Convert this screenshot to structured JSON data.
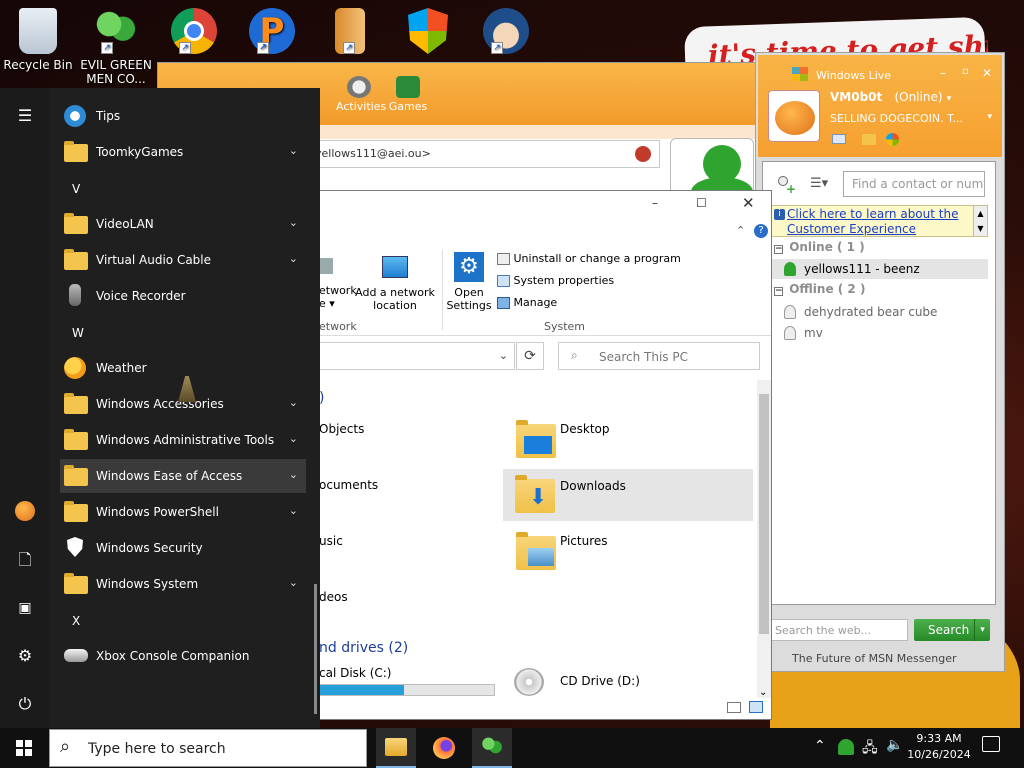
{
  "desktop": {
    "icons": [
      {
        "label": "Recycle Bin",
        "icon": "recycle-bin-icon"
      },
      {
        "label": "EVIL GREEN MEN CO...",
        "icon": "msn-people-icon"
      },
      {
        "label": "",
        "icon": "chrome-icon"
      },
      {
        "label": "",
        "icon": "paint-p-icon"
      },
      {
        "label": "",
        "icon": "bag-app-icon"
      },
      {
        "label": "",
        "icon": "windows-flag-icon"
      },
      {
        "label": "",
        "icon": "anime-character-icon"
      }
    ],
    "wallpaper_text": "it's time to get shit"
  },
  "msn_main": {
    "toolbar": [
      "Activities",
      "Games"
    ],
    "contact_field": "yellows111@aei.ou>"
  },
  "messenger": {
    "title": "Windows Live",
    "username": "VM0b0t",
    "status": "(Online)",
    "personal_message": "SELLING DOGECOIN. T...",
    "search_placeholder": "Find a contact or number...",
    "info_link": "Click here to learn about the Customer Experience",
    "groups": [
      {
        "name": "Online ( 1 )",
        "contacts": [
          "yellows111 - beenz"
        ]
      },
      {
        "name": "Offline ( 2 )",
        "contacts": [
          "dehydrated bear cube",
          "mv"
        ]
      }
    ],
    "web_search_placeholder": "Search the web...",
    "search_button": "Search",
    "footer": "The Future of MSN Messenger"
  },
  "explorer": {
    "ribbon": {
      "network_partial": "etwork",
      "network_partial2": "e ▾",
      "add_network_location": "Add a network location",
      "open_settings": "Open Settings",
      "uninstall": "Uninstall or change a program",
      "system_properties": "System properties",
      "manage": "Manage",
      "group_network": "etwork",
      "group_system": "System"
    },
    "search_placeholder": "Search This PC",
    "folders_left": [
      "Objects",
      "ocuments",
      "usic",
      "deos"
    ],
    "folders_right": [
      "Desktop",
      "Downloads",
      "Pictures"
    ],
    "folders_header_partial": ")",
    "drives_header": "nd drives (2)",
    "drives": [
      {
        "name": "cal Disk (C:)",
        "usage": 0.48
      },
      {
        "name": "CD Drive (D:)"
      }
    ]
  },
  "start_menu": {
    "items": [
      {
        "type": "app",
        "label": "Tips",
        "icon": "tips-bulb-icon"
      },
      {
        "type": "folder",
        "label": "ToomkyGames"
      },
      {
        "type": "letter",
        "label": "V"
      },
      {
        "type": "folder",
        "label": "VideoLAN"
      },
      {
        "type": "folder",
        "label": "Virtual Audio Cable"
      },
      {
        "type": "app",
        "label": "Voice Recorder",
        "icon": "microphone-icon"
      },
      {
        "type": "letter",
        "label": "W"
      },
      {
        "type": "app",
        "label": "Weather",
        "icon": "weather-sun-icon"
      },
      {
        "type": "folder",
        "label": "Windows Accessories"
      },
      {
        "type": "folder",
        "label": "Windows Administrative Tools"
      },
      {
        "type": "folder",
        "label": "Windows Ease of Access"
      },
      {
        "type": "folder",
        "label": "Windows PowerShell"
      },
      {
        "type": "app",
        "label": "Windows Security",
        "icon": "shield-icon"
      },
      {
        "type": "folder",
        "label": "Windows System"
      },
      {
        "type": "letter",
        "label": "X"
      },
      {
        "type": "app",
        "label": "Xbox Console Companion",
        "icon": "xbox-icon"
      }
    ]
  },
  "taskbar": {
    "search_placeholder": "Type here to search",
    "time": "9:33 AM",
    "date": "10/26/2024"
  }
}
